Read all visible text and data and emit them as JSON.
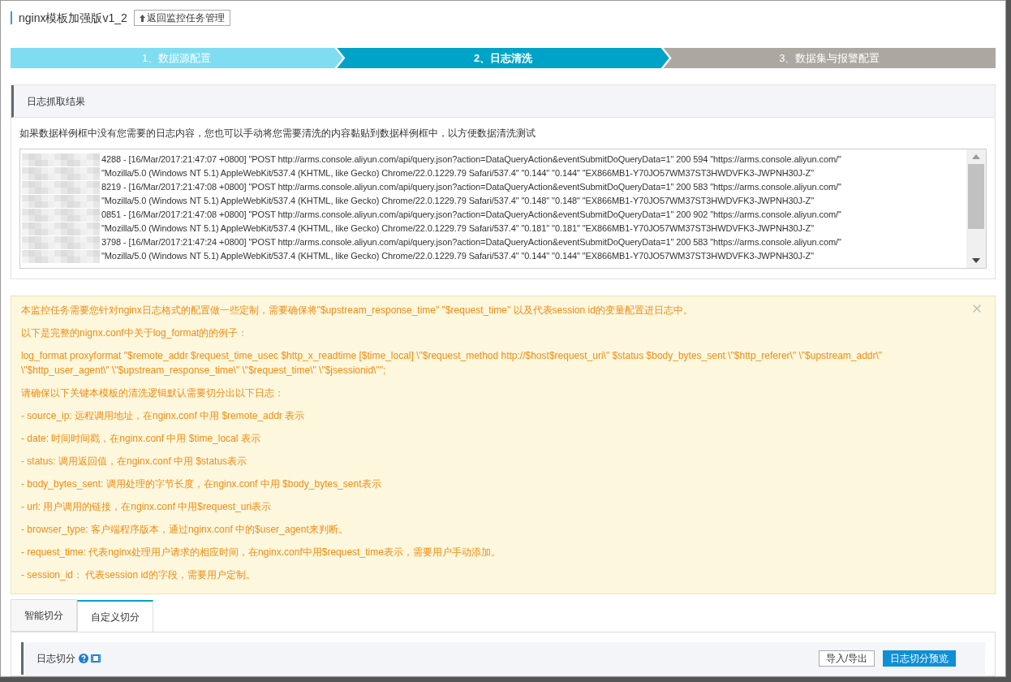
{
  "header": {
    "title": "nginx模板加强版v1_2",
    "back_button": "返回监控任务管理"
  },
  "steps": [
    {
      "label": "1、数据源配置",
      "completed": true,
      "selected": false
    },
    {
      "label": "2、日志清洗",
      "completed": false,
      "selected": true
    },
    {
      "label": "3、数据集与报警配置",
      "completed": false,
      "selected": false
    }
  ],
  "log_panel": {
    "title": "日志抓取结果",
    "hint": "如果数据样例框中没有您需要的日志内容，您也可以手动将您需要清洗的内容黏贴到数据样例框中，以方便数据清洗测试",
    "lines": [
      {
        "text": "4288 - [16/Mar/2017:21:47:07 +0800] \"POST http://arms.console.aliyun.com/api/query.json?action=DataQueryAction&eventSubmitDoQueryData=1\" 200 594 \"https://arms.console.aliyun.com/\""
      },
      {
        "text": "\"Mozilla/5.0 (Windows NT 5.1) AppleWebKit/537.4 (KHTML, like Gecko) Chrome/22.0.1229.79 Safari/537.4\" \"0.144\" \"0.144\" \"EX866MB1-Y70JO57WM37ST3HWDVFK3-JWPNH30J-Z\""
      },
      {
        "text": "8219 - [16/Mar/2017:21:47:08 +0800] \"POST http://arms.console.aliyun.com/api/query.json?action=DataQueryAction&eventSubmitDoQueryData=1\" 200 583 \"https://arms.console.aliyun.com/\""
      },
      {
        "text": "\"Mozilla/5.0 (Windows NT 5.1) AppleWebKit/537.4 (KHTML, like Gecko) Chrome/22.0.1229.79 Safari/537.4\" \"0.148\" \"0.148\" \"EX866MB1-Y70JO57WM37ST3HWDVFK3-JWPNH30J-Z\""
      },
      {
        "text": "0851 - [16/Mar/2017:21:47:08 +0800] \"POST http://arms.console.aliyun.com/api/query.json?action=DataQueryAction&eventSubmitDoQueryData=1\" 200 902 \"https://arms.console.aliyun.com/\""
      },
      {
        "text": "\"Mozilla/5.0 (Windows NT 5.1) AppleWebKit/537.4 (KHTML, like Gecko) Chrome/22.0.1229.79 Safari/537.4\" \"0.181\" \"0.181\" \"EX866MB1-Y70JO57WM37ST3HWDVFK3-JWPNH30J-Z\""
      },
      {
        "text": "3798 - [16/Mar/2017:21:47:24 +0800] \"POST http://arms.console.aliyun.com/api/query.json?action=DataQueryAction&eventSubmitDoQueryData=1\" 200 583 \"https://arms.console.aliyun.com/\""
      },
      {
        "text": "\"Mozilla/5.0 (Windows NT 5.1) AppleWebKit/537.4 (KHTML, like Gecko) Chrome/22.0.1229.79 Safari/537.4\" \"0.144\" \"0.144\" \"EX866MB1-Y70JO57WM37ST3HWDVFK3-JWPNH30J-Z\""
      }
    ]
  },
  "notice": {
    "paragraphs": [
      "本监控任务需要您针对nginx日志格式的配置做一些定制，需要确保将\"$upstream_response_time\" \"$request_time\" 以及代表session id的变量配置进日志中。",
      "以下是完整的nignx.conf中关于log_format的的例子：",
      "log_format proxyformat \"$remote_addr $request_time_usec $http_x_readtime [$time_local] \\\"$request_method http://$host$request_uri\\\" $status $body_bytes_sent \\\"$http_referer\\\" \\\"$upstream_addr\\\" \\\"$http_user_agent\\\" \\\"$upstream_response_time\\\" \\\"$request_time\\\" \\\"$jsessionid\\\"\";",
      "请确保以下关键本模板的清洗逻辑默认需要切分出以下日志：",
      "- source_ip: 远程调用地址，在nginx.conf 中用 $remote_addr 表示",
      "- date: 时间时间戳，在nginx.conf 中用 $time_local 表示",
      "- status: 调用返回值，在nginx.conf 中用 $status表示",
      "- body_bytes_sent: 调用处理的字节长度，在nginx.conf 中用 $body_bytes_sent表示",
      "- url: 用户调用的链接，在nginx.conf 中用$request_uri表示",
      "- browser_type: 客户端程序版本，通过nginx.conf 中的$user_agent来判断。",
      "- request_time: 代表nginx处理用户请求的相应时间，在nginx.conf中用$request_time表示，需要用户手动添加。",
      "- session_id： 代表session id的字段，需要用户定制。"
    ]
  },
  "tabs": [
    {
      "label": "智能切分",
      "selected": false
    },
    {
      "label": "自定义切分",
      "selected": true
    }
  ],
  "split_panel": {
    "title": "日志切分",
    "buttons": [
      {
        "label": "导入/导出",
        "kind": "outline"
      },
      {
        "label": "日志切分预览",
        "kind": "primary"
      }
    ]
  }
}
